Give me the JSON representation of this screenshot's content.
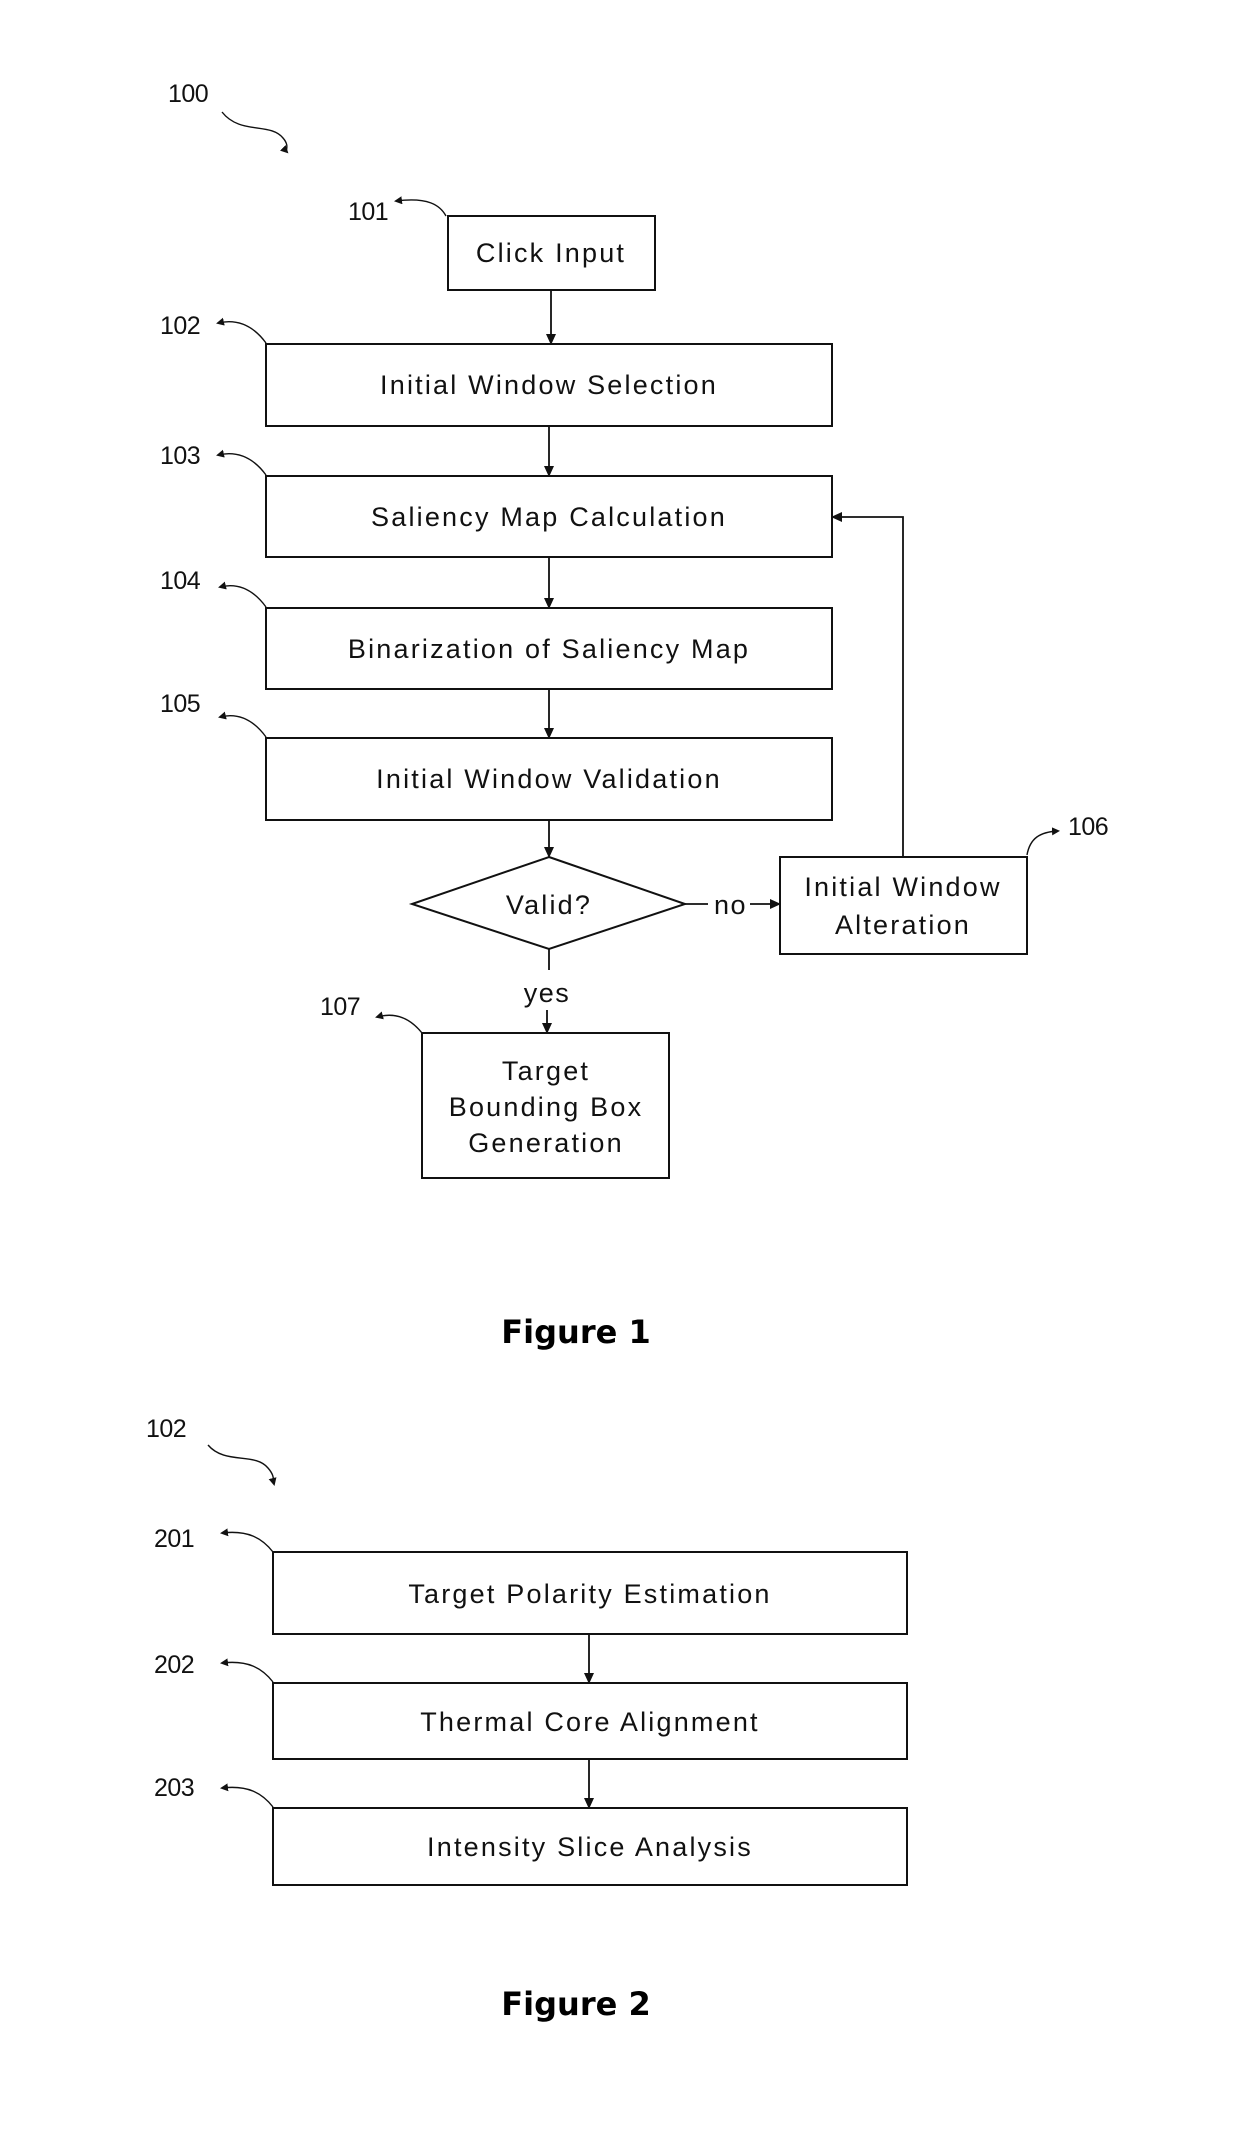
{
  "figure1": {
    "ref": "100",
    "caption": "Figure 1",
    "steps": [
      {
        "ref": "101",
        "lines": [
          "Click Input"
        ]
      },
      {
        "ref": "102",
        "lines": [
          "Initial Window Selection"
        ]
      },
      {
        "ref": "103",
        "lines": [
          "Saliency Map Calculation"
        ]
      },
      {
        "ref": "104",
        "lines": [
          "Binarization of Saliency Map"
        ]
      },
      {
        "ref": "105",
        "lines": [
          "Initial Window Validation"
        ]
      },
      {
        "ref": "106",
        "lines": [
          "Initial Window",
          "Alteration"
        ]
      },
      {
        "ref": "107",
        "lines": [
          "Target",
          "Bounding Box",
          "Generation"
        ]
      }
    ],
    "decision": {
      "label": "Valid?",
      "yes_label": "yes",
      "no_label": "no"
    }
  },
  "figure2": {
    "ref": "102",
    "caption": "Figure 2",
    "steps": [
      {
        "ref": "201",
        "lines": [
          "Target Polarity Estimation"
        ]
      },
      {
        "ref": "202",
        "lines": [
          "Thermal Core Alignment"
        ]
      },
      {
        "ref": "203",
        "lines": [
          "Intensity Slice Analysis"
        ]
      }
    ]
  }
}
